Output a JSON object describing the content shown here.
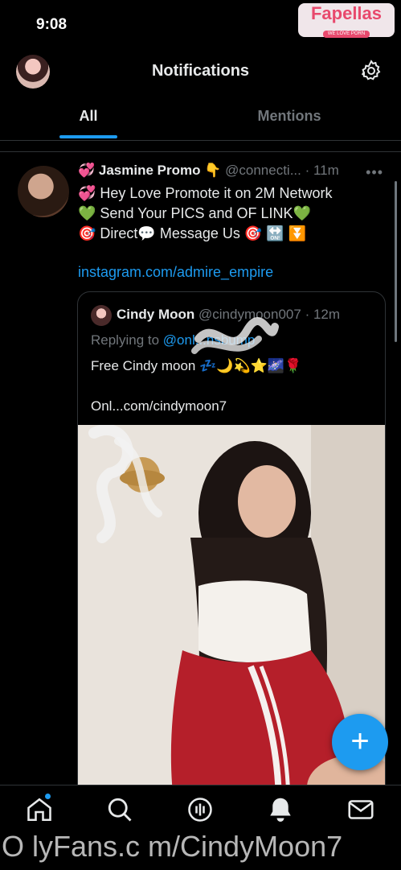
{
  "status_bar": {
    "time": "9:08"
  },
  "watermark_logo": {
    "name": "Fapellas",
    "tagline": "WE LOVE PORN"
  },
  "header": {
    "title": "Notifications"
  },
  "tabs": [
    {
      "label": "All",
      "selected": true
    },
    {
      "label": "Mentions",
      "selected": false
    }
  ],
  "post": {
    "author": "💞 Jasmine Promo 👇",
    "handle": "@connecti...",
    "time": "· 11m",
    "text": "💞 Hey Love Promote it on 2M Network\n💚 Send Your PICS and OF LINK💚\n🎯 Direct💬 Message Us 🎯 🔛 ⏬",
    "link": "instagram.com/admire_empire",
    "quote": {
      "name": "Cindy Moon",
      "handle": "@cindymoon007",
      "time": "· 12m",
      "replying_prefix": "Replying to ",
      "replying_to": "@onl...nsbump",
      "text": "Free Cindy moon 💤🌙💫⭐🌌🌹",
      "link": "Onl...com/cindymoon7"
    }
  },
  "fab": {
    "icon": "compose-plus-icon",
    "symbol": "+"
  },
  "bottom_nav": [
    {
      "icon": "home-icon"
    },
    {
      "icon": "search-icon"
    },
    {
      "icon": "spaces-icon"
    },
    {
      "icon": "notifications-bell-icon"
    },
    {
      "icon": "messages-icon"
    }
  ],
  "watermark_text": "O lyFans.c m/CindyMoon7",
  "colors": {
    "accent": "#1d9bf0",
    "background": "#000000",
    "muted": "#71767b"
  }
}
